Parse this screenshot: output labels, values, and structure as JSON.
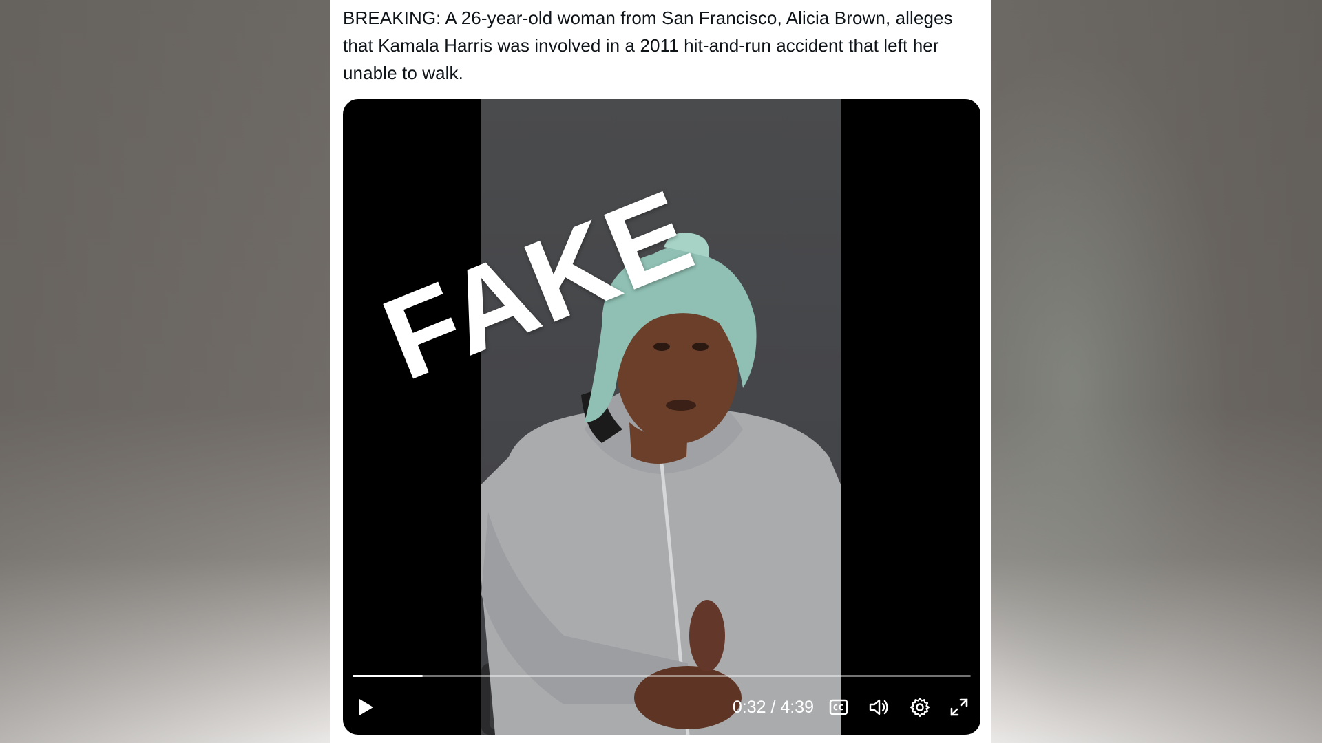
{
  "tweet": {
    "text": "BREAKING: A 26-year-old woman from San Francisco, Alicia Brown, alleges that Kamala Harris was involved in a 2011 hit-and-run accident that left her unable to walk."
  },
  "video": {
    "overlay_stamp": "FAKE",
    "current_time": "0:32",
    "duration": "4:39",
    "time_display": "0:32 / 4:39",
    "progress_fraction": 0.114,
    "icons": {
      "play": "play-icon",
      "captions": "captions-icon",
      "volume": "volume-icon",
      "settings": "gear-icon",
      "fullscreen": "fullscreen-icon"
    }
  },
  "colors": {
    "card_background": "#ffffff",
    "text": "#0f1419",
    "player_background": "#000000",
    "controls": "#ffffff"
  }
}
